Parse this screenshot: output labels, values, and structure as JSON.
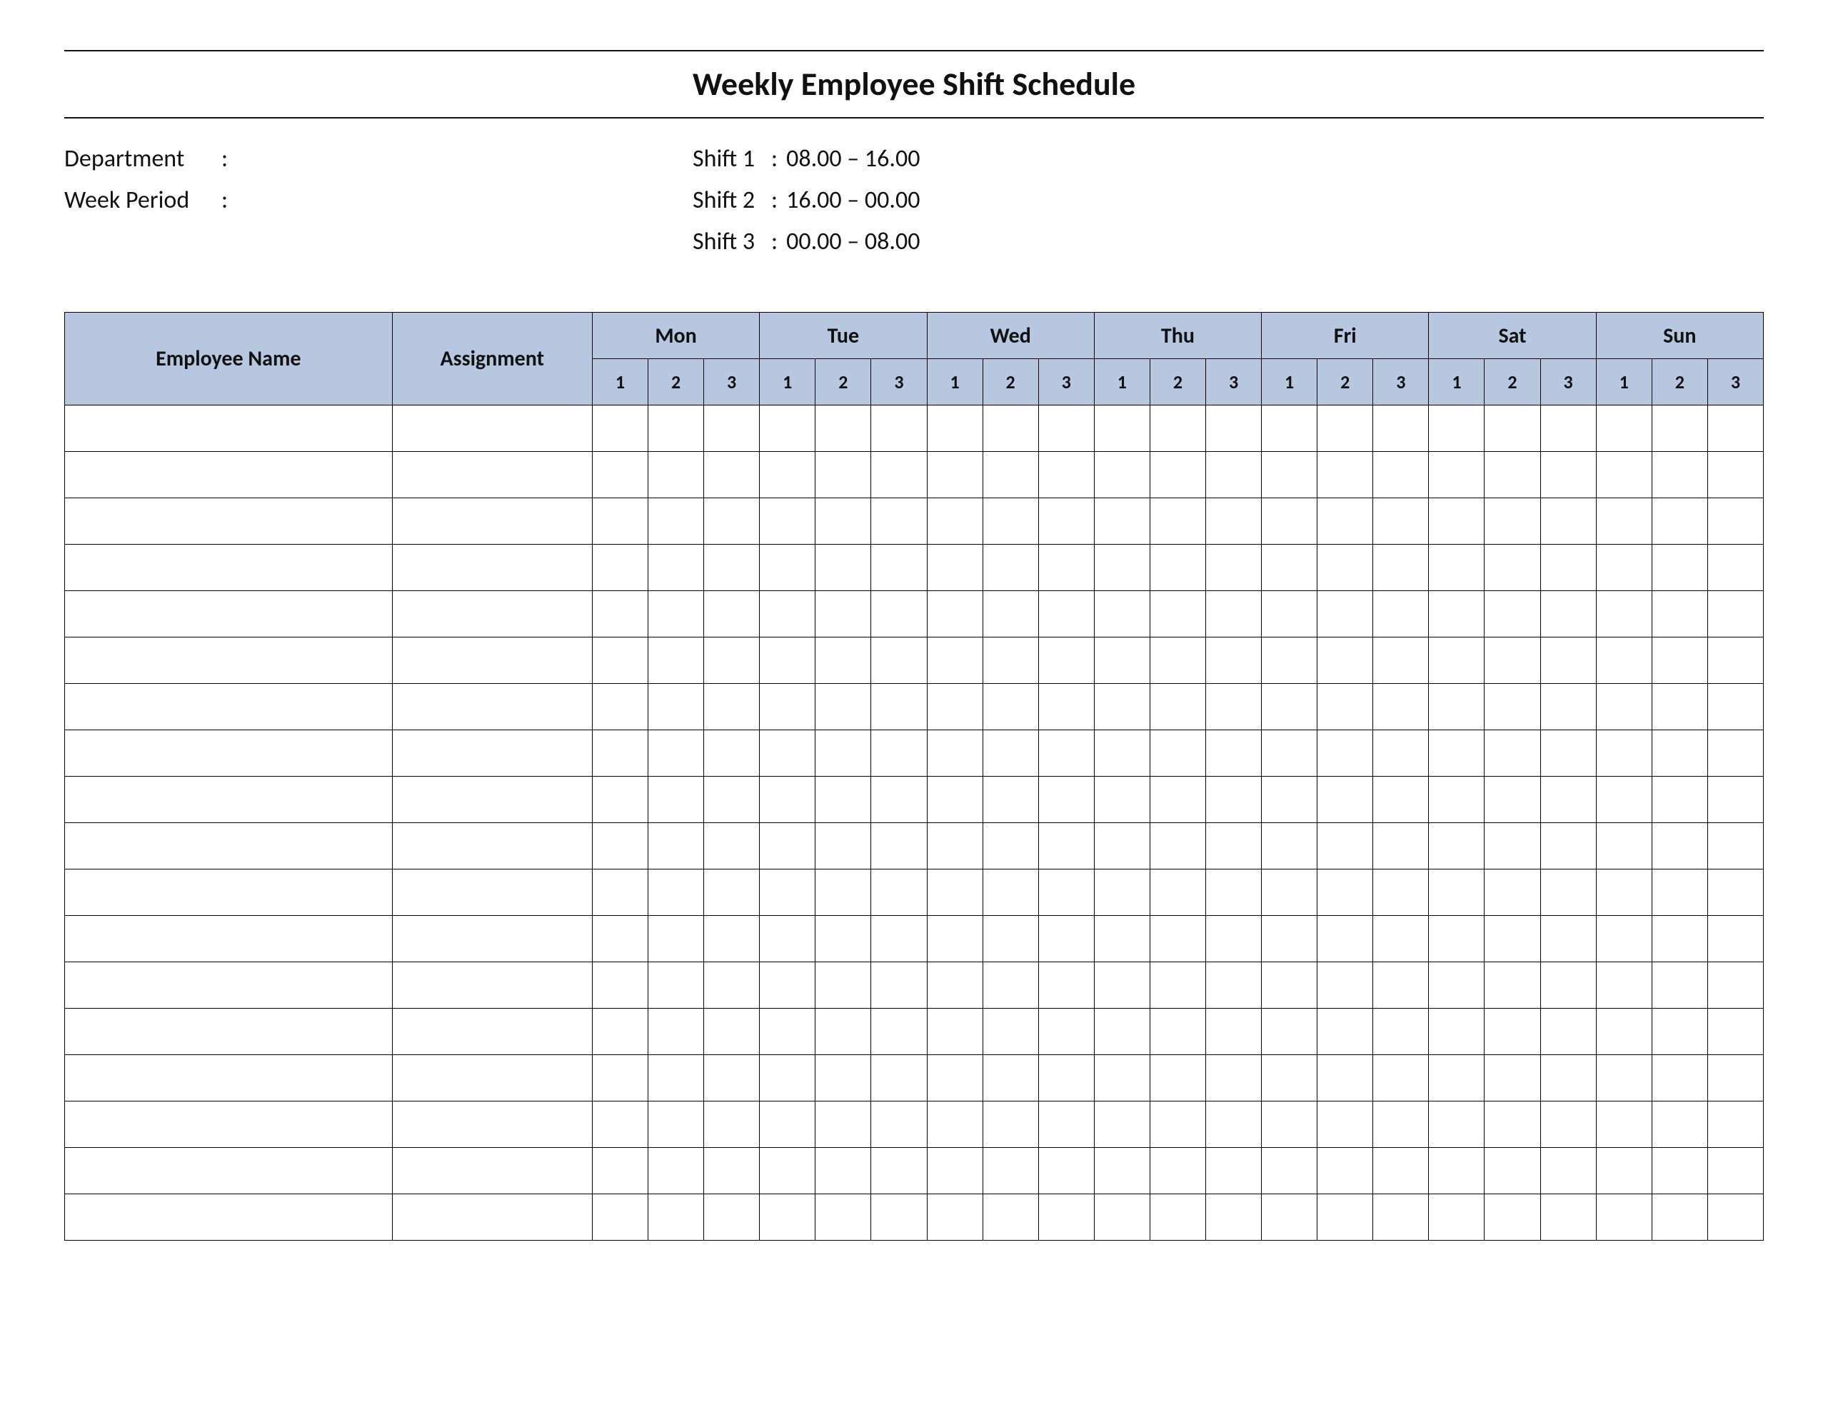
{
  "title": "Weekly Employee Shift Schedule",
  "meta": {
    "department_label": "Department",
    "department_value": "",
    "week_period_label": "Week  Period",
    "week_period_value": ""
  },
  "shifts": [
    {
      "label": "Shift 1",
      "range": "08.00  – 16.00"
    },
    {
      "label": "Shift 2",
      "range": "16.00  – 00.00"
    },
    {
      "label": "Shift 3",
      "range": "00.00  – 08.00"
    }
  ],
  "columns": {
    "employee_name": "Employee Name",
    "assignment": "Assignment",
    "days": [
      "Mon",
      "Tue",
      "Wed",
      "Thu",
      "Fri",
      "Sat",
      "Sun"
    ],
    "sub_shifts": [
      "1",
      "2",
      "3"
    ]
  },
  "rows": [
    {
      "name": "",
      "assignment": "",
      "cells": [
        "",
        "",
        "",
        "",
        "",
        "",
        "",
        "",
        "",
        "",
        "",
        "",
        "",
        "",
        "",
        "",
        "",
        "",
        "",
        "",
        ""
      ]
    },
    {
      "name": "",
      "assignment": "",
      "cells": [
        "",
        "",
        "",
        "",
        "",
        "",
        "",
        "",
        "",
        "",
        "",
        "",
        "",
        "",
        "",
        "",
        "",
        "",
        "",
        "",
        ""
      ]
    },
    {
      "name": "",
      "assignment": "",
      "cells": [
        "",
        "",
        "",
        "",
        "",
        "",
        "",
        "",
        "",
        "",
        "",
        "",
        "",
        "",
        "",
        "",
        "",
        "",
        "",
        "",
        ""
      ]
    },
    {
      "name": "",
      "assignment": "",
      "cells": [
        "",
        "",
        "",
        "",
        "",
        "",
        "",
        "",
        "",
        "",
        "",
        "",
        "",
        "",
        "",
        "",
        "",
        "",
        "",
        "",
        ""
      ]
    },
    {
      "name": "",
      "assignment": "",
      "cells": [
        "",
        "",
        "",
        "",
        "",
        "",
        "",
        "",
        "",
        "",
        "",
        "",
        "",
        "",
        "",
        "",
        "",
        "",
        "",
        "",
        ""
      ]
    },
    {
      "name": "",
      "assignment": "",
      "cells": [
        "",
        "",
        "",
        "",
        "",
        "",
        "",
        "",
        "",
        "",
        "",
        "",
        "",
        "",
        "",
        "",
        "",
        "",
        "",
        "",
        ""
      ]
    },
    {
      "name": "",
      "assignment": "",
      "cells": [
        "",
        "",
        "",
        "",
        "",
        "",
        "",
        "",
        "",
        "",
        "",
        "",
        "",
        "",
        "",
        "",
        "",
        "",
        "",
        "",
        ""
      ]
    },
    {
      "name": "",
      "assignment": "",
      "cells": [
        "",
        "",
        "",
        "",
        "",
        "",
        "",
        "",
        "",
        "",
        "",
        "",
        "",
        "",
        "",
        "",
        "",
        "",
        "",
        "",
        ""
      ]
    },
    {
      "name": "",
      "assignment": "",
      "cells": [
        "",
        "",
        "",
        "",
        "",
        "",
        "",
        "",
        "",
        "",
        "",
        "",
        "",
        "",
        "",
        "",
        "",
        "",
        "",
        "",
        ""
      ]
    },
    {
      "name": "",
      "assignment": "",
      "cells": [
        "",
        "",
        "",
        "",
        "",
        "",
        "",
        "",
        "",
        "",
        "",
        "",
        "",
        "",
        "",
        "",
        "",
        "",
        "",
        "",
        ""
      ]
    },
    {
      "name": "",
      "assignment": "",
      "cells": [
        "",
        "",
        "",
        "",
        "",
        "",
        "",
        "",
        "",
        "",
        "",
        "",
        "",
        "",
        "",
        "",
        "",
        "",
        "",
        "",
        ""
      ]
    },
    {
      "name": "",
      "assignment": "",
      "cells": [
        "",
        "",
        "",
        "",
        "",
        "",
        "",
        "",
        "",
        "",
        "",
        "",
        "",
        "",
        "",
        "",
        "",
        "",
        "",
        "",
        ""
      ]
    },
    {
      "name": "",
      "assignment": "",
      "cells": [
        "",
        "",
        "",
        "",
        "",
        "",
        "",
        "",
        "",
        "",
        "",
        "",
        "",
        "",
        "",
        "",
        "",
        "",
        "",
        "",
        ""
      ]
    },
    {
      "name": "",
      "assignment": "",
      "cells": [
        "",
        "",
        "",
        "",
        "",
        "",
        "",
        "",
        "",
        "",
        "",
        "",
        "",
        "",
        "",
        "",
        "",
        "",
        "",
        "",
        ""
      ]
    },
    {
      "name": "",
      "assignment": "",
      "cells": [
        "",
        "",
        "",
        "",
        "",
        "",
        "",
        "",
        "",
        "",
        "",
        "",
        "",
        "",
        "",
        "",
        "",
        "",
        "",
        "",
        ""
      ]
    },
    {
      "name": "",
      "assignment": "",
      "cells": [
        "",
        "",
        "",
        "",
        "",
        "",
        "",
        "",
        "",
        "",
        "",
        "",
        "",
        "",
        "",
        "",
        "",
        "",
        "",
        "",
        ""
      ]
    },
    {
      "name": "",
      "assignment": "",
      "cells": [
        "",
        "",
        "",
        "",
        "",
        "",
        "",
        "",
        "",
        "",
        "",
        "",
        "",
        "",
        "",
        "",
        "",
        "",
        "",
        "",
        ""
      ]
    },
    {
      "name": "",
      "assignment": "",
      "cells": [
        "",
        "",
        "",
        "",
        "",
        "",
        "",
        "",
        "",
        "",
        "",
        "",
        "",
        "",
        "",
        "",
        "",
        "",
        "",
        "",
        ""
      ]
    }
  ]
}
